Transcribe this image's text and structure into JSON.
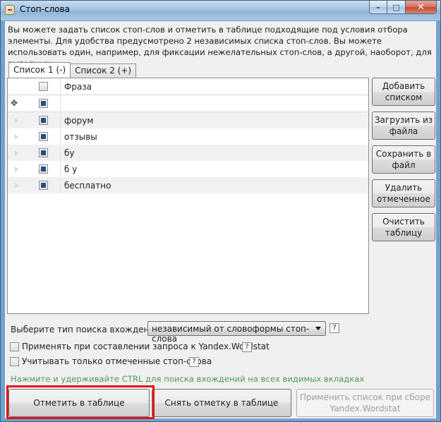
{
  "window": {
    "title": "Стоп-слова",
    "caption": {
      "minimize": "–",
      "maximize": "□",
      "close": "✕"
    }
  },
  "description": "Вы можете задать список стоп-слов и отметить в таблице подходящие под условия отбора элементы. Для удобства предусмотрено 2 независимых списка стоп-слов. Вы можете использовать один, например, для фиксации нежелательных стоп-слов, а другой, наоборот, для выгодных.",
  "tabs": [
    {
      "label": "Список 1 (-)",
      "active": true
    },
    {
      "label": "Список 2 (+)",
      "active": false
    }
  ],
  "grid": {
    "header": "Фраза",
    "new_row_icon": "✥",
    "rows": [
      {
        "phrase": "форум",
        "checked": true
      },
      {
        "phrase": "отзывы",
        "checked": true
      },
      {
        "phrase": "бу",
        "checked": true
      },
      {
        "phrase": "б у",
        "checked": true
      },
      {
        "phrase": "бесплатно",
        "checked": true
      }
    ]
  },
  "side_buttons": {
    "add_list": "Добавить списком",
    "load_file": "Загрузить из файла",
    "save_file": "Сохранить в файл",
    "delete_checked": "Удалить отмеченное",
    "clear_table": "Очистить таблицу"
  },
  "search_type": {
    "label": "Выберите тип поиска вхождений:",
    "selected": "независимый от словоформы стоп-слова"
  },
  "help_mark": "?",
  "options": {
    "apply_wordstat": "Применять при составлении запроса к Yandex.Wordstat",
    "checked_only": "Учитывать только отмеченные стоп-слова"
  },
  "hint": "Нажмите и удерживайте CTRL для поиска вхождений на всех видимых вкладках",
  "bottom_buttons": {
    "mark": "Отметить в таблице",
    "unmark": "Снять отметку в таблице",
    "apply_wordstat": "Применить список при сборе Yandex.Wordstat"
  },
  "colors": {
    "highlight": "#e0161b",
    "hint": "#4f9c4f",
    "checkbox_mark": "#2b4a8a"
  }
}
